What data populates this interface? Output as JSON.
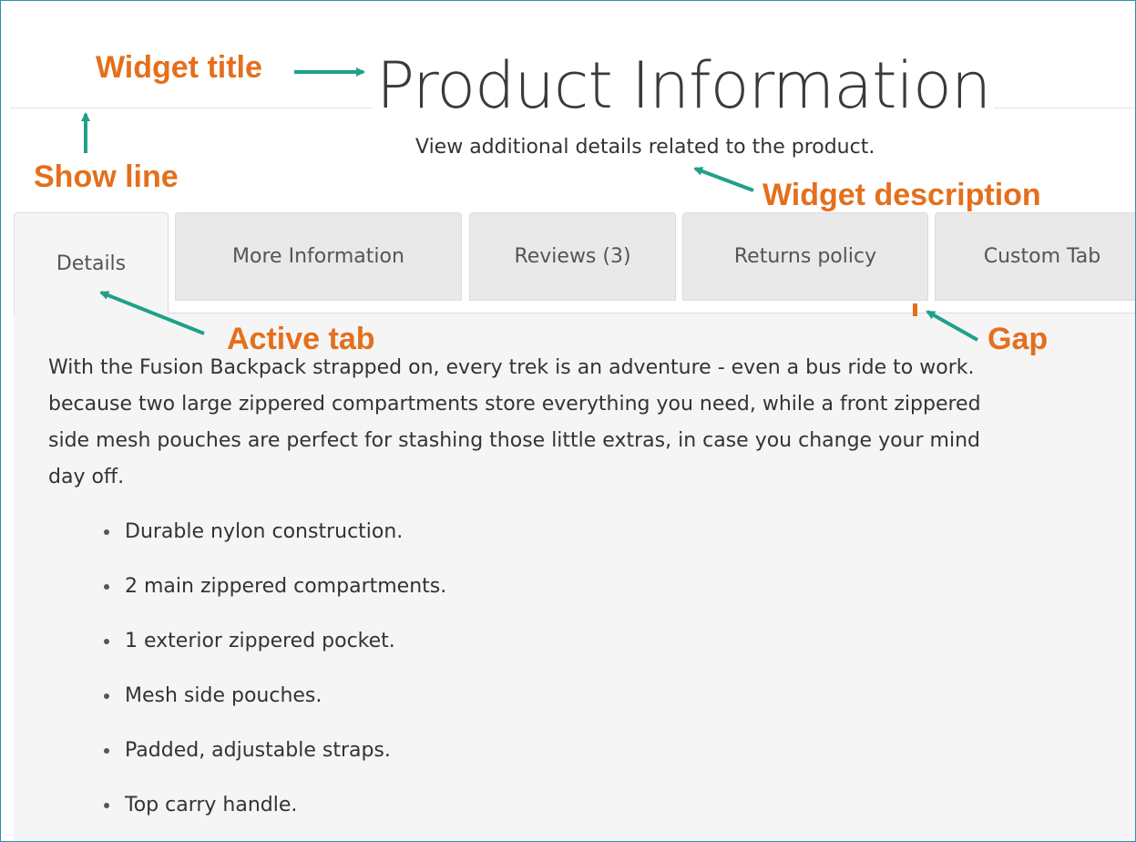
{
  "widget": {
    "title": "Product Information",
    "description": "View additional details related to the product."
  },
  "tabs": [
    {
      "label": "Details",
      "active": true
    },
    {
      "label": "More Information",
      "active": false
    },
    {
      "label": "Reviews (3)",
      "active": false
    },
    {
      "label": "Returns policy",
      "active": false
    },
    {
      "label": "Custom Tab",
      "active": false
    }
  ],
  "content": {
    "paragraph_lines": [
      "With the Fusion Backpack strapped on, every trek is an adventure - even a bus ride to work.",
      "because two large zippered compartments store everything you need, while a front zippered",
      "side mesh pouches are perfect for stashing those little extras, in case you change your mind",
      "day off."
    ],
    "features": [
      "Durable nylon construction.",
      "2 main zippered compartments.",
      "1 exterior zippered pocket.",
      "Mesh side pouches.",
      "Padded, adjustable straps.",
      "Top carry handle."
    ]
  },
  "annotations": {
    "widget_title": "Widget title",
    "show_line": "Show line",
    "widget_description": "Widget description",
    "active_tab": "Active tab",
    "gap": "Gap"
  },
  "colors": {
    "annotation_text": "#e46f1c",
    "annotation_arrow": "#1fa08a",
    "frame_border": "#2f8fb4",
    "tab_bg": "#e9e9e9",
    "content_bg": "#f5f5f5"
  }
}
